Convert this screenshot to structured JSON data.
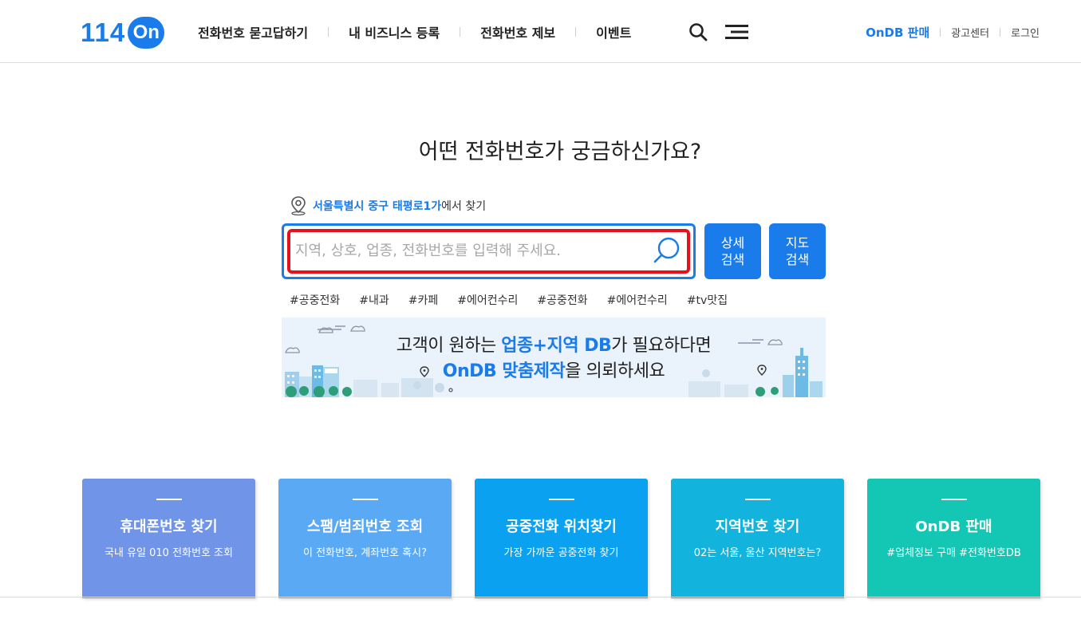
{
  "header": {
    "logo_num": "114",
    "logo_on": "On",
    "nav": [
      "전화번호 묻고답하기",
      "내 비즈니스 등록",
      "전화번호 제보",
      "이벤트"
    ],
    "util": [
      "OnDB 판매",
      "광고센터",
      "로그인"
    ]
  },
  "main": {
    "headline": "어떤 전화번호가 궁금하신가요?",
    "location_link": "서울특별시 중구 태평로1가",
    "location_suffix": "에서 찾기",
    "search_placeholder": "지역, 상호, 업종, 전화번호를 입력해 주세요.",
    "search_value": "",
    "detail_search": [
      "상세",
      "검색"
    ],
    "map_search": [
      "지도",
      "검색"
    ],
    "tags": [
      "#공중전화",
      "#내과",
      "#카페",
      "#에어컨수리",
      "#공중전화",
      "#에어컨수리",
      "#tv맛집"
    ],
    "banner": {
      "line1_pre": "고객이 원하는 ",
      "line1_hl": "업종+지역 DB",
      "line1_post": "가 필요하다면",
      "line2_hl": "OnDB 맞춤제작",
      "line2_post": "을 의뢰하세요"
    }
  },
  "cards": [
    {
      "title": "휴대폰번호 찾기",
      "sub": "국내 유일 010 전화번호 조회",
      "color": "#7094e8"
    },
    {
      "title": "스팸/범죄번호 조회",
      "sub": "이 전화번호, 계좌번호 혹시?",
      "color": "#5aa9f4"
    },
    {
      "title": "공중전화 위치찾기",
      "sub": "가장 가까운 공중전화 찾기",
      "color": "#0ba1f1"
    },
    {
      "title": "지역번호 찾기",
      "sub": "02는 서울, 울산 지역번호는?",
      "color": "#12b4dd"
    },
    {
      "title": "OnDB 판매",
      "sub": "#업체정보 구매 #전화번호DB",
      "color": "#13c7b4"
    }
  ],
  "colors": {
    "brand": "#1a7bea",
    "highlight": "#e8101a"
  }
}
